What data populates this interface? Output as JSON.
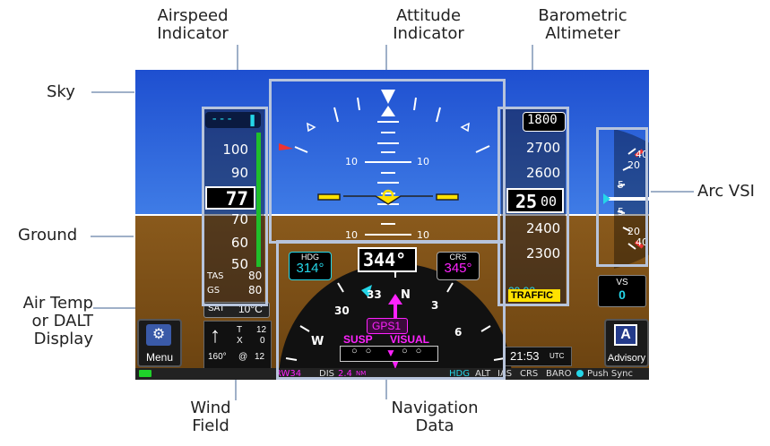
{
  "callouts": {
    "airspeed": [
      "Airspeed",
      "Indicator"
    ],
    "attitude": [
      "Attitude",
      "Indicator"
    ],
    "baro": [
      "Barometric",
      "Altimeter"
    ],
    "sky": "Sky",
    "ground": "Ground",
    "arc_vsi": "Arc VSI",
    "air_temp": [
      "Air Temp",
      "or DALT",
      "Display"
    ],
    "wind": [
      "Wind",
      "Field"
    ],
    "nav": [
      "Navigation",
      "Data"
    ]
  },
  "airspeed": {
    "selected": "---",
    "ticks": [
      "100",
      "90",
      "70",
      "60",
      "50"
    ],
    "current": "77",
    "tas_label": "TAS",
    "tas_value": "80",
    "gs_label": "GS",
    "gs_value": "80"
  },
  "attitude": {
    "pitch_up_left": "10",
    "pitch_up_right": "10",
    "pitch_down_left": "10",
    "pitch_down_right": "10"
  },
  "altimeter": {
    "selected": "1800",
    "ticks": [
      "2700",
      "2600",
      "2400",
      "2300"
    ],
    "current_big": "25",
    "current_small": "00",
    "baro_value": "29.92",
    "baro_unit": "IN",
    "traffic": "TRAFFIC"
  },
  "vsi": {
    "marks": [
      "40",
      "20",
      "5",
      "5",
      "20",
      "40"
    ],
    "label": "VS",
    "value": "0"
  },
  "hsi": {
    "hdg_label": "HDG",
    "hdg_value": "314°",
    "crs_label": "CRS",
    "crs_value": "345°",
    "heading": "344°",
    "compass_labels": [
      "W",
      "30",
      "33",
      "N",
      "3",
      "6"
    ],
    "source": "GPS1",
    "susp": "SUSP",
    "visual": "VISUAL"
  },
  "sat": {
    "label": "SAT",
    "value": "10°C"
  },
  "wind": {
    "t_label": "T",
    "t_value": "12",
    "x_label": "X",
    "x_value": "0",
    "dir": "160°",
    "at": "@",
    "speed": "12"
  },
  "buttons": {
    "menu": "Menu",
    "advisory": "Advisory",
    "advisory_letter": "A"
  },
  "clock": {
    "time": "21:53",
    "tz": "UTC"
  },
  "bottom_bar": {
    "waypoint": "RW34",
    "dis_label": "DIS",
    "dis_value": "2.4",
    "dis_unit": "NM",
    "hdg": "HDG",
    "alt": "ALT",
    "ias": "IAS",
    "crs": "CRS",
    "baro": "BARO",
    "push_sync": "Push Sync"
  },
  "colors": {
    "sky": "#2a62d8",
    "ground": "#7a4e16",
    "cyan": "#25d6e8",
    "magenta": "#ff22ff",
    "yellow": "#ffe100",
    "frame": "#b7c4dc"
  }
}
